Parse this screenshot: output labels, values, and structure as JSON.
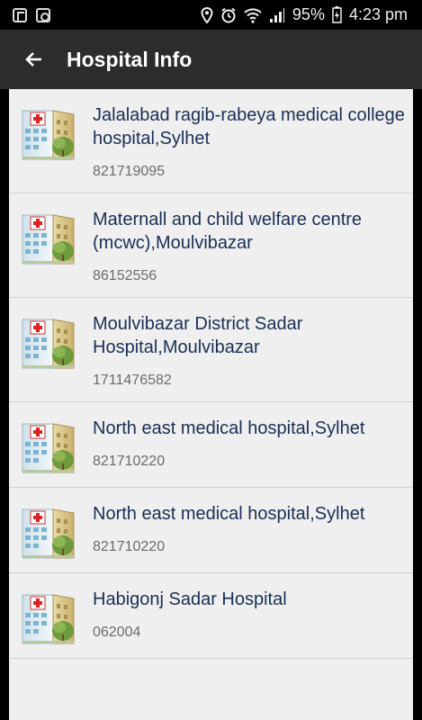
{
  "status_bar": {
    "battery": "95%",
    "time": "4:23 pm"
  },
  "app_bar": {
    "title": "Hospital Info",
    "back_icon": "arrow-back-icon"
  },
  "hospitals": [
    {
      "name": " Jalalabad ragib-rabeya medical college hospital,Sylhet",
      "phone": "821719095"
    },
    {
      "name": " Maternall and child welfare centre (mcwc),Moulvibazar",
      "phone": "86152556"
    },
    {
      "name": " Moulvibazar District Sadar Hospital,Moulvibazar",
      "phone": "1711476582"
    },
    {
      "name": " North east medical hospital,Sylhet",
      "phone": "821710220"
    },
    {
      "name": " North east medical hospital,Sylhet",
      "phone": "821710220"
    },
    {
      "name": "Habigonj Sadar Hospital",
      "phone": "062004"
    }
  ],
  "item_icon": "hospital-building-icon",
  "colors": {
    "app_bar": "#2c2c2c",
    "list_bg": "#efefef",
    "name_text": "#1b2e55",
    "phone_text": "#6b6b6b"
  }
}
